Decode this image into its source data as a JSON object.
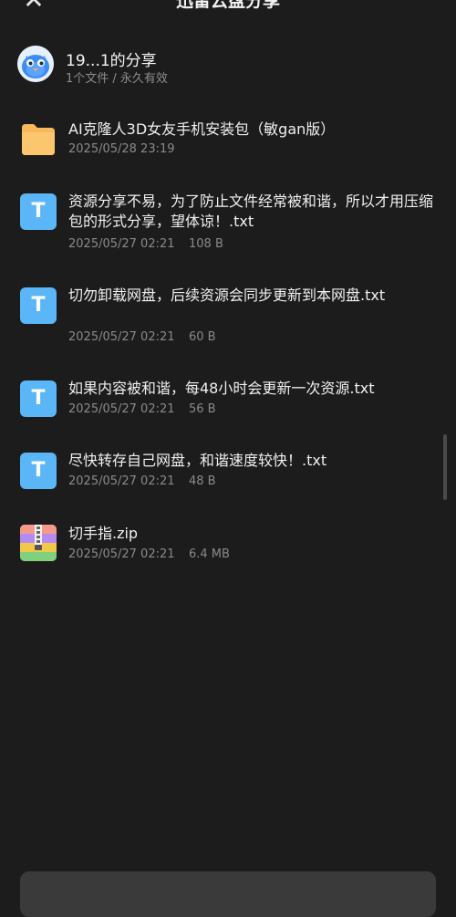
{
  "header": {
    "title": "迅雷云盘分享",
    "close_icon": "close-icon"
  },
  "sharer": {
    "name": "19...1的分享",
    "meta": "1个文件 / 永久有效"
  },
  "files": [
    {
      "icon": "folder-icon",
      "name": "AI克隆人3D女友手机安装包（敏gan版）",
      "date": "2025/05/28 23:19",
      "size": ""
    },
    {
      "icon": "text-file-icon",
      "name": "资源分享不易，为了防止文件经常被和谐，所以才用压缩包的形式分享，望体谅！.txt",
      "date": "2025/05/27 02:21",
      "size": "108 B"
    },
    {
      "icon": "text-file-icon",
      "name": "切勿卸载网盘，后续资源会同步更新到本网盘.txt",
      "date": "2025/05/27 02:21",
      "size": "60 B"
    },
    {
      "icon": "text-file-icon",
      "name": "如果内容被和谐，每48小时会更新一次资源.txt",
      "date": "2025/05/27 02:21",
      "size": "56 B"
    },
    {
      "icon": "text-file-icon",
      "name": "尽快转存自己网盘，和谐速度较快！.txt",
      "date": "2025/05/27 02:21",
      "size": "48 B"
    },
    {
      "icon": "zip-file-icon",
      "name": "切手指.zip",
      "date": "2025/05/27 02:21",
      "size": "6.4 MB"
    }
  ],
  "colors": {
    "background": "#1c1c1c",
    "folder": "#f7b95b",
    "text_file": "#5ab6f7"
  }
}
